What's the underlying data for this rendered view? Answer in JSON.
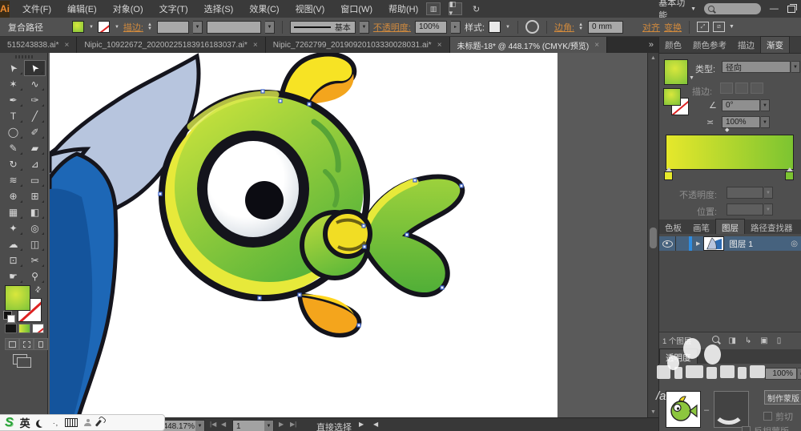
{
  "menu_bar": {
    "logo": "Ai",
    "items": [
      "文件(F)",
      "编辑(E)",
      "对象(O)",
      "文字(T)",
      "选择(S)",
      "效果(C)",
      "视图(V)",
      "窗口(W)",
      "帮助(H)"
    ],
    "workspace": "基本功能"
  },
  "control_bar": {
    "selection_type": "复合路径",
    "stroke_label": "描边:",
    "brush_definition": "基本",
    "opacity_label": "不透明度:",
    "opacity_value": "100%",
    "style_label": "样式:",
    "corner_label": "边角:",
    "corner_value": "0 mm",
    "align_link": "对齐",
    "transform_link": "变换"
  },
  "document_tabs": {
    "tabs": [
      {
        "label": "515243838.ai*",
        "active": false
      },
      {
        "label": "Nipic_10922672_20200225183916183037.ai*",
        "active": false
      },
      {
        "label": "Nipic_7262799_20190920103330028031.ai*",
        "active": false
      },
      {
        "label": "未标题-18* @ 448.17% (CMYK/预览)",
        "active": true
      }
    ],
    "overflow": "»"
  },
  "tools": [
    {
      "name": "selection-tool",
      "glyph": "➤",
      "rot": true,
      "active": false
    },
    {
      "name": "direct-selection-tool",
      "glyph": "➤",
      "rot": true,
      "active": true
    },
    {
      "name": "magic-wand-tool",
      "glyph": "✶"
    },
    {
      "name": "lasso-tool",
      "glyph": "∿"
    },
    {
      "name": "pen-tool",
      "glyph": "✒"
    },
    {
      "name": "anchor-point-tool",
      "glyph": "✑"
    },
    {
      "name": "type-tool",
      "glyph": "T"
    },
    {
      "name": "line-segment-tool",
      "glyph": "╱"
    },
    {
      "name": "ellipse-tool",
      "glyph": "◯"
    },
    {
      "name": "paintbrush-tool",
      "glyph": "✐"
    },
    {
      "name": "pencil-tool",
      "glyph": "✎"
    },
    {
      "name": "eraser-tool",
      "glyph": "▰"
    },
    {
      "name": "rotate-tool",
      "glyph": "↻"
    },
    {
      "name": "scale-tool",
      "glyph": "⊿"
    },
    {
      "name": "width-tool",
      "glyph": "≋"
    },
    {
      "name": "free-transform-tool",
      "glyph": "▭"
    },
    {
      "name": "shape-builder-tool",
      "glyph": "⊕"
    },
    {
      "name": "perspective-grid-tool",
      "glyph": "⊞"
    },
    {
      "name": "mesh-tool",
      "glyph": "▦"
    },
    {
      "name": "gradient-tool",
      "glyph": "◧"
    },
    {
      "name": "eyedropper-tool",
      "glyph": "✦"
    },
    {
      "name": "blend-tool",
      "glyph": "◎"
    },
    {
      "name": "symbol-sprayer-tool",
      "glyph": "☁"
    },
    {
      "name": "column-graph-tool",
      "glyph": "◫"
    },
    {
      "name": "artboard-tool",
      "glyph": "⊡"
    },
    {
      "name": "slice-tool",
      "glyph": "✂"
    },
    {
      "name": "hand-tool",
      "glyph": "☛"
    },
    {
      "name": "zoom-tool",
      "glyph": "⚲"
    }
  ],
  "panels": {
    "group1": {
      "tabs": [
        "颜色",
        "颜色参考",
        "描边",
        "渐变"
      ],
      "active_index": 3
    },
    "gradient": {
      "type_label": "类型:",
      "type_value": "径向",
      "stroke_label": "描边:",
      "angle_value": "0°",
      "aspect_value": "100%",
      "opacity_label": "不透明度:",
      "location_label": "位置:",
      "stops": [
        {
          "color": "#e6e82b"
        },
        {
          "color": "#7cc431"
        }
      ]
    },
    "group2": {
      "tabs": [
        "色板",
        "画笔",
        "图层",
        "路径查找器"
      ],
      "active_index": 2
    },
    "layers": {
      "layer_name": "图层 1",
      "count_text": "1 个图层"
    },
    "group3": {
      "tabs": [
        "透明度"
      ],
      "active_index": 0
    },
    "transparency": {
      "opacity_value": "100%",
      "make_mask": "制作蒙版",
      "clip_label": "剪切",
      "invert_label": "反相蒙版"
    }
  },
  "status_bar": {
    "zoom_value": "448.17%",
    "artboard_value": "1",
    "tool_name": "直接选择"
  },
  "ime_bar": {
    "logo": "S",
    "lang": "英"
  },
  "watermark": {
    "fragment": "/an."
  },
  "artwork_colors": {
    "green_fish_body_light": "#d4e73d",
    "green_fish_body_dark": "#56b33a",
    "green_fish_rim_yellow": "#e7e93a",
    "fin_yellow": "#f7e324",
    "fin_orange": "#f3a51d",
    "outline_black": "#14141c",
    "blue_fish_tail_light": "#b7c5de",
    "blue_fish_tail_shade": "#8fa6c9",
    "blue_fish_body": "#1d67b6",
    "blue_fish_body_dark": "#14549c"
  }
}
